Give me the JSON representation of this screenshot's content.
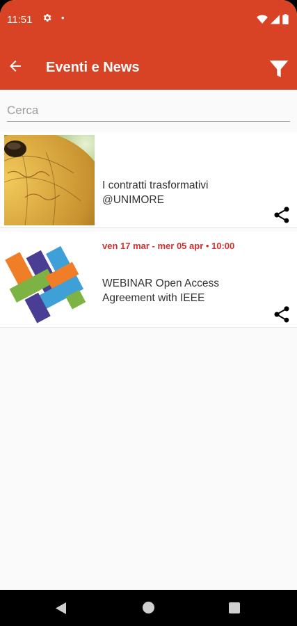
{
  "status_bar": {
    "time": "11:51",
    "dot": "•"
  },
  "app_bar": {
    "title": "Eventi e News"
  },
  "search": {
    "placeholder": "Cerca",
    "value": ""
  },
  "items": [
    {
      "date": "",
      "title": "I contratti trasformativi @UNIMORE",
      "thumbnail": "globe-image"
    },
    {
      "date": "ven 17 mar  - mer 05 apr • 10:00",
      "title": "WEBINAR Open Access Agreement with IEEE",
      "thumbnail": "woven-ribbons-logo"
    }
  ],
  "colors": {
    "accent": "#d84325",
    "date": "#d32f2f"
  }
}
